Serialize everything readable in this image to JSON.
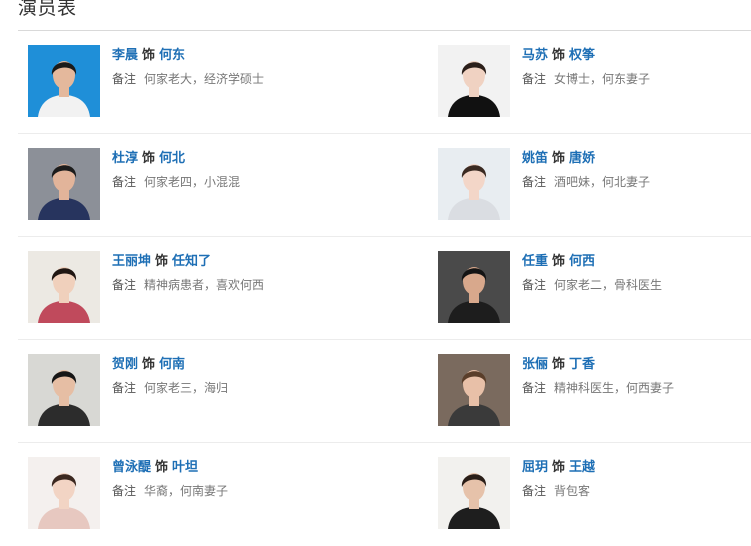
{
  "section": {
    "title": "演员表"
  },
  "labels": {
    "as_word": "饰",
    "note_label": "备注"
  },
  "colors": {
    "link_blue": "#1e6fb5",
    "divider": "#ececec"
  },
  "cast": [
    {
      "actor": "李晨",
      "role": "何东",
      "note": "何家老大，经济学硕士",
      "photo": {
        "bg": "#1f8fd8",
        "skin": "#e4b89c",
        "hair": "#1a1a1a",
        "cloth": "#f2f2f2"
      }
    },
    {
      "actor": "马苏",
      "role": "权筝",
      "note": "女博士，何东妻子",
      "photo": {
        "bg": "#f2f2f2",
        "skin": "#f0d2c2",
        "hair": "#2b1f1a",
        "cloth": "#111111"
      }
    },
    {
      "actor": "杜淳",
      "role": "何北",
      "note": "何家老四，小混混",
      "photo": {
        "bg": "#8c9098",
        "skin": "#e2b49a",
        "hair": "#1c1c1c",
        "cloth": "#27345e"
      }
    },
    {
      "actor": "姚笛",
      "role": "唐娇",
      "note": "酒吧妹，何北妻子",
      "photo": {
        "bg": "#e8edf1",
        "skin": "#f3d6c8",
        "hair": "#3a2a22",
        "cloth": "#dadde2"
      }
    },
    {
      "actor": "王丽坤",
      "role": "任知了",
      "note": "精神病患者，喜欢何西",
      "photo": {
        "bg": "#ece9e3",
        "skin": "#f0d0bc",
        "hair": "#201612",
        "cloth": "#c04a5c"
      }
    },
    {
      "actor": "任重",
      "role": "何西",
      "note": "何家老二，骨科医生",
      "photo": {
        "bg": "#4a4a4a",
        "skin": "#d8a88c",
        "hair": "#141414",
        "cloth": "#1d1d1d"
      }
    },
    {
      "actor": "贺刚",
      "role": "何南",
      "note": "何家老三，海归",
      "photo": {
        "bg": "#d8d8d4",
        "skin": "#e6bea4",
        "hair": "#161616",
        "cloth": "#2c2c2c"
      }
    },
    {
      "actor": "张俪",
      "role": "丁香",
      "note": "精神科医生，何西妻子",
      "photo": {
        "bg": "#7a6a5e",
        "skin": "#e8c0a8",
        "hair": "#5a3e2a",
        "cloth": "#3a3a3a"
      }
    },
    {
      "actor": "曾泳醍",
      "role": "叶坦",
      "note": "华裔，何南妻子",
      "photo": {
        "bg": "#f4f0ee",
        "skin": "#f2d4c4",
        "hair": "#3b2820",
        "cloth": "#e7c8c0"
      }
    },
    {
      "actor": "屈玥",
      "role": "王越",
      "note": "背包客",
      "photo": {
        "bg": "#f2f1ee",
        "skin": "#e6c2aa",
        "hair": "#2a1e18",
        "cloth": "#1e1e1e"
      }
    }
  ]
}
